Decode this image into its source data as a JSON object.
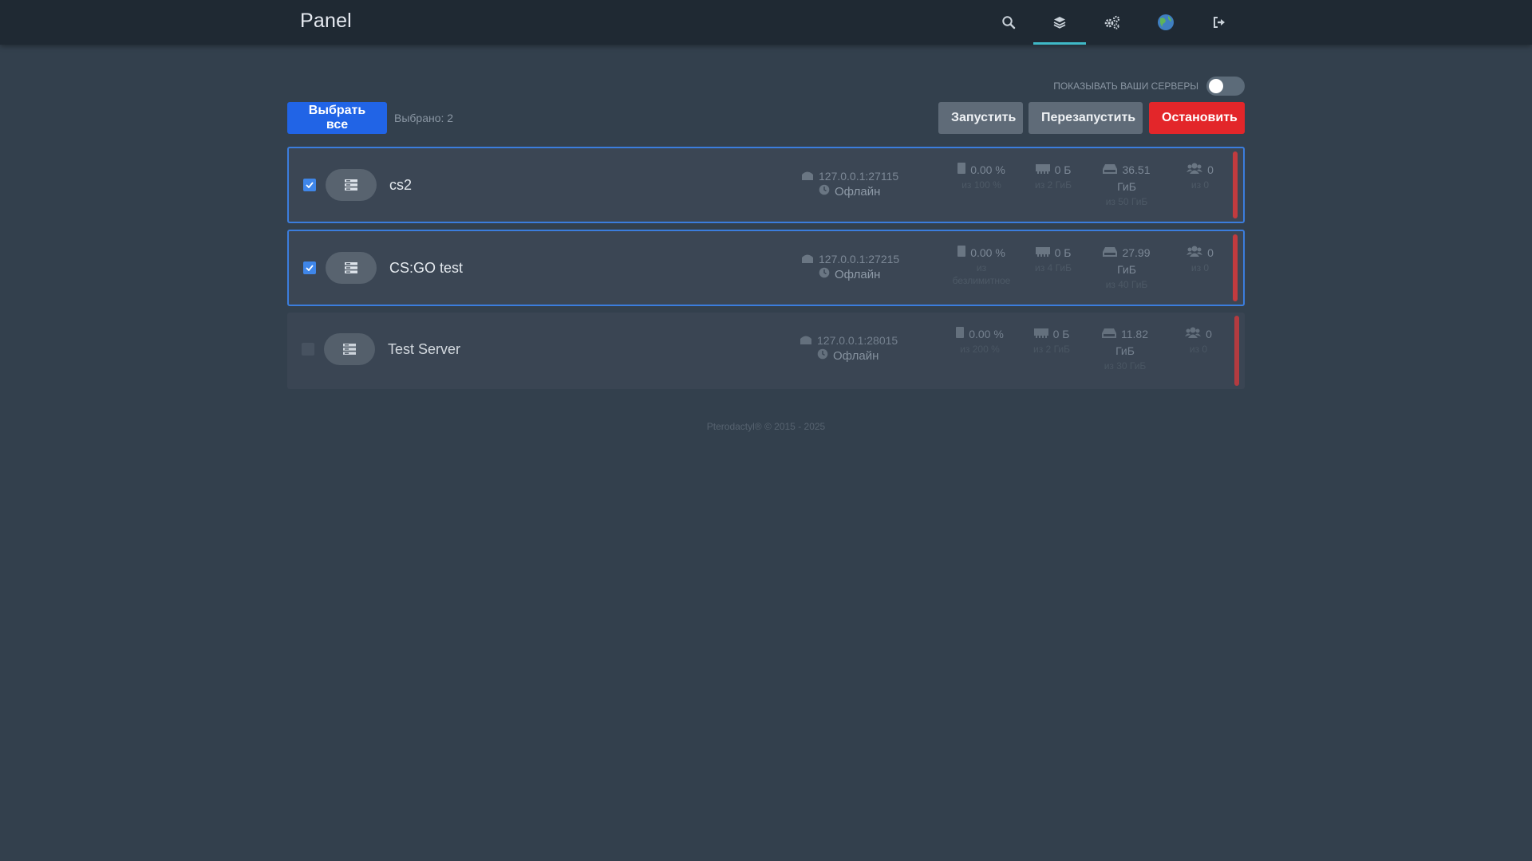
{
  "nav": {
    "brand": "Panel",
    "icons": [
      "search-icon",
      "layers-icon",
      "cogs-icon",
      "globe-icon",
      "sign-out-icon"
    ],
    "active_icon": "layers-icon",
    "accent": "#3fb9c7"
  },
  "toolbar": {
    "toggle_label": "ПОКАЗЫВАТЬ ВАШИ СЕРВЕРЫ",
    "toggle_on": false,
    "select_all_label": "Выбрать все",
    "selected_text": "Выбрано: 2",
    "start_label": "Запустить",
    "restart_label": "Перезапустить",
    "stop_label": "Остановить"
  },
  "servers": [
    {
      "name": "cs2",
      "checked": true,
      "address": "127.0.0.1:27115",
      "status": "Офлайн",
      "cpu": "0.00 %",
      "cpu_limit": "из 100 %",
      "memory": "0 Б",
      "memory_limit": "из 2 ГиБ",
      "disk": "36.51",
      "disk_unit": "ГиБ",
      "disk_limit": "из 50 ГиБ",
      "players": "0",
      "players_limit": "из 0"
    },
    {
      "name": "CS:GO test",
      "checked": true,
      "address": "127.0.0.1:27215",
      "status": "Офлайн",
      "cpu": "0.00 %",
      "cpu_limit": "из",
      "cpu_limit2": "безлимитное",
      "memory": "0 Б",
      "memory_limit": "из 4 ГиБ",
      "disk": "27.99",
      "disk_unit": "ГиБ",
      "disk_limit": "из 40 ГиБ",
      "players": "0",
      "players_limit": "из 0"
    },
    {
      "name": "Test Server",
      "checked": false,
      "address": "127.0.0.1:28015",
      "status": "Офлайн",
      "cpu": "0.00 %",
      "cpu_limit": "из 200 %",
      "memory": "0 Б",
      "memory_limit": "из 2 ГиБ",
      "disk": "11.82",
      "disk_unit": "ГиБ",
      "disk_limit": "из 30 ГиБ",
      "players": "0",
      "players_limit": "из 0"
    }
  ],
  "footer": "Pterodactyl® © 2015 - 2025",
  "colors": {
    "background": "#33404d",
    "topbar": "#1f2933",
    "row": "#3b4654",
    "select_border": "#3b7ddd",
    "primary": "#2164e6",
    "danger": "#e3262a",
    "offline_bar": "#c13b3f"
  }
}
